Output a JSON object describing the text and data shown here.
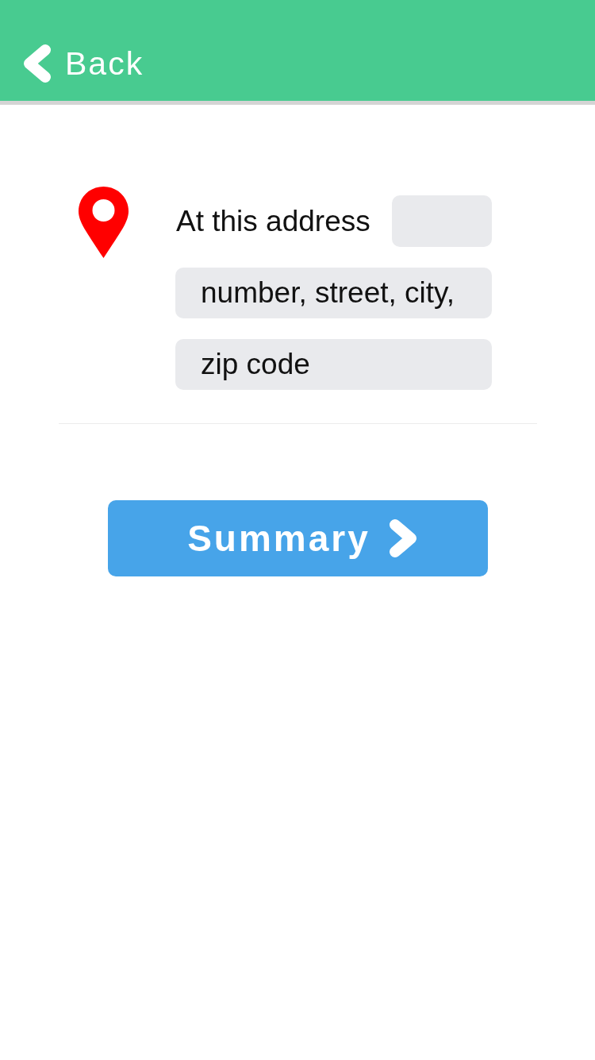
{
  "header": {
    "back_label": "Back"
  },
  "address": {
    "label": "At this address",
    "fields": [
      {
        "kind": "short"
      },
      {
        "kind": "wide",
        "placeholder": "number, street, city,"
      },
      {
        "kind": "wide",
        "placeholder": "zip code"
      }
    ]
  },
  "button": {
    "label": "Summary"
  }
}
